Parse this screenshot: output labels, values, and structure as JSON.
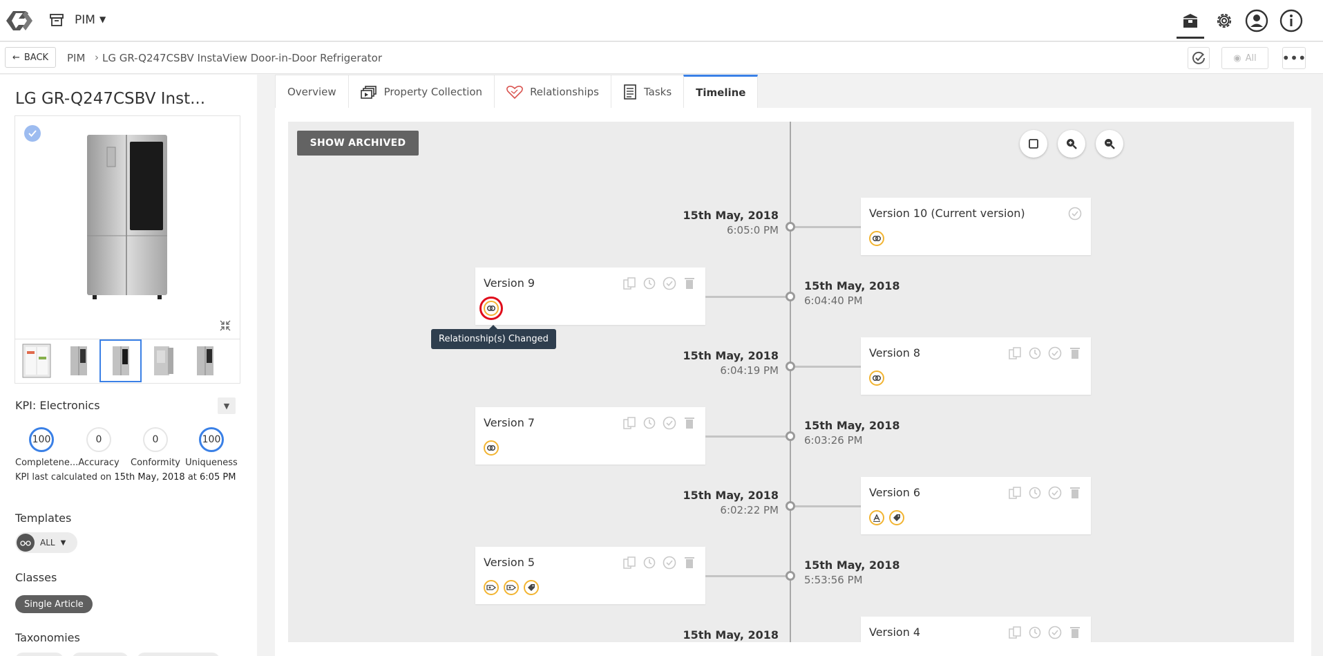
{
  "header": {
    "module": "PIM",
    "icons": [
      "app-logo-icon",
      "archive-box-icon",
      "package-icon",
      "gear-icon",
      "user-account-icon",
      "info-icon"
    ]
  },
  "breadcrumb": {
    "back_label": "BACK",
    "root": "PIM",
    "current": "LG GR-Q247CSBV InstaView Door-in-Door Refrigerator",
    "visibility_label": "All"
  },
  "product": {
    "title": "LG GR-Q247CSBV Inst...",
    "kpi": {
      "label": "KPI:  Electronics",
      "items": [
        {
          "value": "100",
          "name": "Completene..."
        },
        {
          "value": "0",
          "name": "Accuracy"
        },
        {
          "value": "0",
          "name": "Conformity"
        },
        {
          "value": "100",
          "name": "Uniqueness"
        }
      ],
      "calc_prefix": "KPI last calculated on",
      "calc_date": "15th May, 2018",
      "calc_at": "at",
      "calc_time": "6:05 PM"
    },
    "templates_label": "Templates",
    "templates_value": "ALL",
    "classes_label": "Classes",
    "class_chip": "Single Article",
    "taxonomies_label": "Taxonomies"
  },
  "tabs": [
    {
      "label": "Overview",
      "active": false
    },
    {
      "label": "Property Collection",
      "active": false
    },
    {
      "label": "Relationships",
      "active": false
    },
    {
      "label": "Tasks",
      "active": false
    },
    {
      "label": "Timeline",
      "active": true
    }
  ],
  "timeline": {
    "show_archived_label": "SHOW ARCHIVED",
    "tooltip": "Relationship(s) Changed",
    "versions": [
      {
        "title": "Version 10 (Current version)",
        "date": "15th May, 2018",
        "time": "6:05:0 PM",
        "side": "right",
        "changes": [
          "relationship-changed-icon"
        ]
      },
      {
        "title": "Version 9",
        "date": "15th May, 2018",
        "time": "6:04:40 PM",
        "side": "left",
        "changes": [
          "relationship-changed-icon"
        ]
      },
      {
        "title": "Version 8",
        "date": "15th May, 2018",
        "time": "6:04:19 PM",
        "side": "right",
        "changes": [
          "relationship-changed-icon"
        ]
      },
      {
        "title": "Version 7",
        "date": "15th May, 2018",
        "time": "6:03:26 PM",
        "side": "left",
        "changes": [
          "relationship-changed-icon"
        ]
      },
      {
        "title": "Version 6",
        "date": "15th May, 2018",
        "time": "6:02:22 PM",
        "side": "right",
        "changes": [
          "attribute-changed-icon",
          "tag-changed-icon"
        ]
      },
      {
        "title": "Version 5",
        "date": "15th May, 2018",
        "time": "5:53:56 PM",
        "side": "left",
        "changes": [
          "asset-changed-icon",
          "asset-changed-icon",
          "tag-changed-icon"
        ]
      },
      {
        "title": "Version 4",
        "date": "15th May, 2018",
        "time": "",
        "side": "right",
        "changes": []
      }
    ]
  },
  "colors": {
    "accent": "#3a80e6",
    "change_ring": "#f2b431",
    "highlight": "#e00d1b",
    "tooltip_bg": "#2e3e4e",
    "button_dark": "#636363"
  }
}
